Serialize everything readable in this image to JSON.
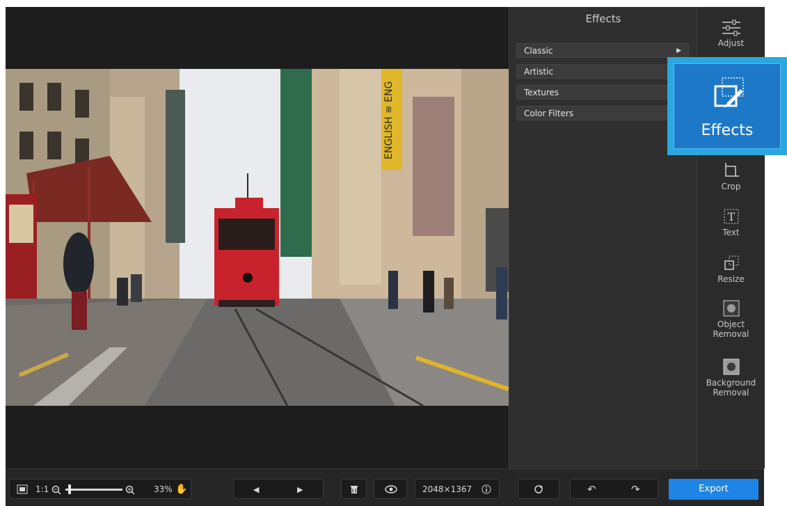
{
  "panel": {
    "title": "Effects",
    "categories": [
      {
        "label": "Classic",
        "expand_icon": "triangle-right-icon"
      },
      {
        "label": "Artistic"
      },
      {
        "label": "Textures"
      },
      {
        "label": "Color Filters"
      }
    ]
  },
  "tools": [
    {
      "id": "adjust",
      "label": "Adjust",
      "icon": "sliders-icon"
    },
    {
      "id": "effects",
      "label": "Effects",
      "icon": "effects-brush-icon",
      "active": true
    },
    {
      "id": "crop",
      "label": "Crop",
      "icon": "crop-icon"
    },
    {
      "id": "text",
      "label": "Text",
      "icon": "text-icon"
    },
    {
      "id": "resize",
      "label": "Resize",
      "icon": "resize-icon"
    },
    {
      "id": "object-removal",
      "label": "Object Removal",
      "label_lines": [
        "Object",
        "Removal"
      ],
      "icon": "object-removal-icon"
    },
    {
      "id": "background-removal",
      "label": "Background Removal",
      "label_lines": [
        "Background",
        "Removal"
      ],
      "icon": "background-removal-icon"
    }
  ],
  "bottombar": {
    "fit_label": "1:1",
    "zoom_value": "33%",
    "dimensions": "2048×1367",
    "export_label": "Export"
  },
  "photo": {
    "sign_text": "ENGLISH ≡ ENG"
  },
  "colors": {
    "accent_blue": "#1e85e6",
    "highlight_blue": "#29a8e0",
    "tram_red": "#c8232c"
  }
}
